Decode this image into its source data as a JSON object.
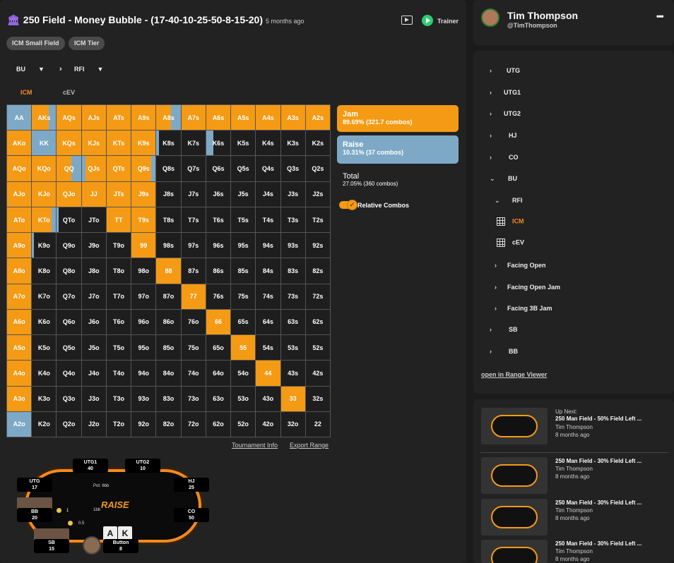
{
  "header": {
    "title": "250 Field - Money Bubble - (17-40-10-25-50-8-15-20)",
    "ago": "5 months ago",
    "trainer_label": "Trainer",
    "chips": [
      "ICM Small Field",
      "ICM Tier"
    ]
  },
  "selectors": {
    "position": "BU",
    "action": "RFI"
  },
  "tabs": {
    "icm": "ICM",
    "cev": "cEV"
  },
  "colors": {
    "jam": "#f59a14",
    "raise": "#7ea9c6",
    "fold": "#1e1e1e",
    "accent": "#f58a1f"
  },
  "grid": [
    [
      "AA",
      "AKs",
      "AQs",
      "AJs",
      "ATs",
      "A9s",
      "A8s",
      "A7s",
      "A6s",
      "A5s",
      "A4s",
      "A3s",
      "A2s"
    ],
    [
      "AKo",
      "KK",
      "KQs",
      "KJs",
      "KTs",
      "K9s",
      "K8s",
      "K7s",
      "K6s",
      "K5s",
      "K4s",
      "K3s",
      "K2s"
    ],
    [
      "AQo",
      "KQo",
      "QQ",
      "QJs",
      "QTs",
      "Q9s",
      "Q8s",
      "Q7s",
      "Q6s",
      "Q5s",
      "Q4s",
      "Q3s",
      "Q2s"
    ],
    [
      "AJo",
      "KJo",
      "QJo",
      "JJ",
      "JTs",
      "J9s",
      "J8s",
      "J7s",
      "J6s",
      "J5s",
      "J4s",
      "J3s",
      "J2s"
    ],
    [
      "ATo",
      "KTo",
      "QTo",
      "JTo",
      "TT",
      "T9s",
      "T8s",
      "T7s",
      "T6s",
      "T5s",
      "T4s",
      "T3s",
      "T2s"
    ],
    [
      "A9o",
      "K9o",
      "Q9o",
      "J9o",
      "T9o",
      "99",
      "98s",
      "97s",
      "96s",
      "95s",
      "94s",
      "93s",
      "92s"
    ],
    [
      "A8o",
      "K8o",
      "Q8o",
      "J8o",
      "T8o",
      "98o",
      "88",
      "87s",
      "86s",
      "85s",
      "84s",
      "83s",
      "82s"
    ],
    [
      "A7o",
      "K7o",
      "Q7o",
      "J7o",
      "T7o",
      "97o",
      "87o",
      "77",
      "76s",
      "75s",
      "74s",
      "73s",
      "72s"
    ],
    [
      "A6o",
      "K6o",
      "Q6o",
      "J6o",
      "T6o",
      "96o",
      "86o",
      "76o",
      "66",
      "65s",
      "64s",
      "63s",
      "62s"
    ],
    [
      "A5o",
      "K5o",
      "Q5o",
      "J5o",
      "T5o",
      "95o",
      "85o",
      "75o",
      "65o",
      "55",
      "54s",
      "53s",
      "52s"
    ],
    [
      "A4o",
      "K4o",
      "Q4o",
      "J4o",
      "T4o",
      "94o",
      "84o",
      "74o",
      "64o",
      "54o",
      "44",
      "43s",
      "42s"
    ],
    [
      "A3o",
      "K3o",
      "Q3o",
      "J3o",
      "T3o",
      "93o",
      "83o",
      "73o",
      "63o",
      "53o",
      "43o",
      "33",
      "32s"
    ],
    [
      "A2o",
      "K2o",
      "Q2o",
      "J2o",
      "T2o",
      "92o",
      "82o",
      "72o",
      "62o",
      "52o",
      "42o",
      "32o",
      "22"
    ]
  ],
  "legend": {
    "jam_label": "Jam",
    "jam_value": "89.69% (321.7 combos)",
    "raise_label": "Raise",
    "raise_value": "10.31% (37 combos)",
    "total_label": "Total",
    "total_value": "27.05% (360 combos)",
    "relative_label": "Relative Combos"
  },
  "footer_links": {
    "tournament_info": "Tournament Info",
    "export_range": "Export Range"
  },
  "table": {
    "seats": [
      {
        "name": "UTG1",
        "stack": "40"
      },
      {
        "name": "UTG2",
        "stack": "10"
      },
      {
        "name": "UTG",
        "stack": "17"
      },
      {
        "name": "HJ",
        "stack": "25"
      },
      {
        "name": "BB",
        "stack": "20"
      },
      {
        "name": "CO",
        "stack": "50"
      },
      {
        "name": "SB",
        "stack": "15"
      },
      {
        "name": "Button",
        "stack": "8"
      }
    ],
    "pot": "Pot: 6bb",
    "bb_amount": "1bb",
    "sb_amount": "0.5",
    "cards": [
      "A",
      "K"
    ],
    "brand": "RAISE"
  },
  "profile": {
    "name": "Tim Thompson",
    "handle": "@TimThompson"
  },
  "tree": {
    "items": [
      "UTG",
      "UTG1",
      "UTG2",
      "HJ",
      "CO",
      "BU"
    ],
    "rfi": "RFI",
    "icm": "ICM",
    "cev": "cEV",
    "sub": [
      "Facing Open",
      "Facing Open Jam",
      "Facing 3B Jam"
    ],
    "tail": [
      "SB",
      "BB"
    ],
    "open_link": "open in Range Viewer"
  },
  "up_next": {
    "label": "Up Next:",
    "items": [
      {
        "title": "250 Man Field - 50% Field Left ...",
        "author": "Tim Thompson",
        "ago": "8 months ago"
      },
      {
        "title": "250 Man Field - 30% Field Left ...",
        "author": "Tim Thompson",
        "ago": "8 months ago"
      },
      {
        "title": "250 Man Field - 30% Field Left ...",
        "author": "Tim Thompson",
        "ago": "8 months ago"
      },
      {
        "title": "250 Man Field - 30% Field Left ...",
        "author": "Tim Thompson",
        "ago": "8 months ago"
      }
    ]
  }
}
